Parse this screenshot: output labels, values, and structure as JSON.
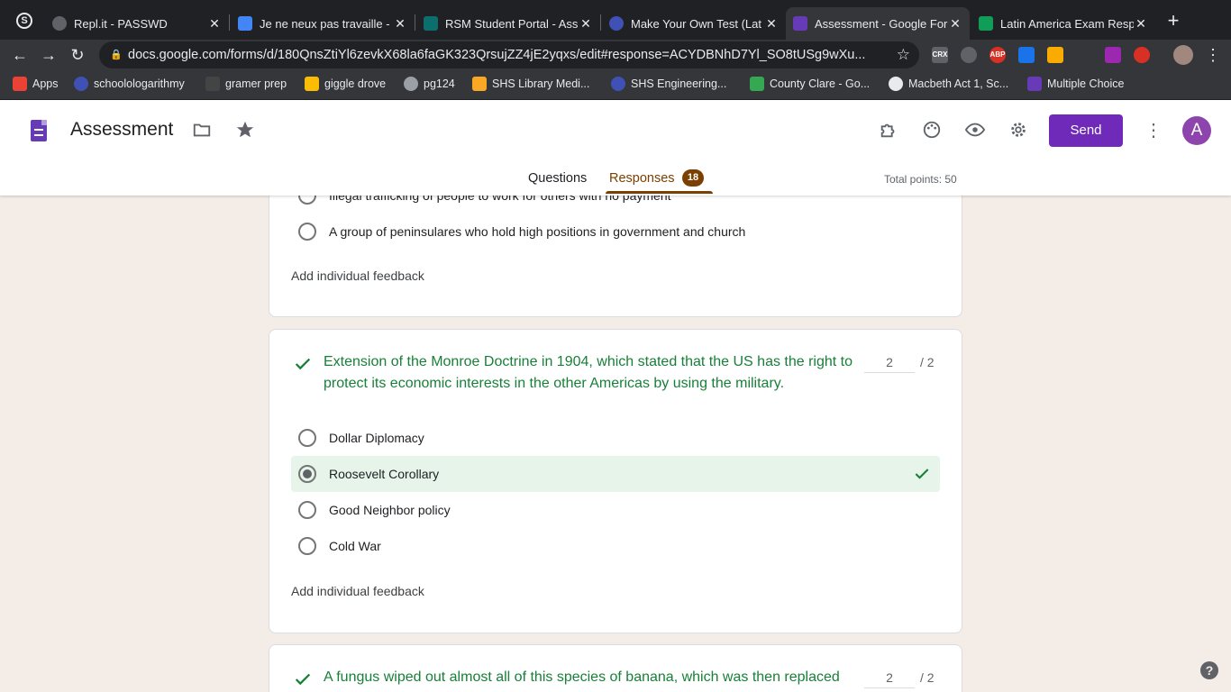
{
  "browser": {
    "tabs": [
      {
        "title": "Repl.it - PASSWD",
        "color": "#5f6368"
      },
      {
        "title": "Je ne neux pas travaille -",
        "color": "#4285f4"
      },
      {
        "title": "RSM Student Portal - Ass",
        "color": "#0d6e6e"
      },
      {
        "title": "Make Your Own Test (Lat",
        "color": "#3f51b5"
      },
      {
        "title": "Assessment - Google For",
        "color": "#673ab7"
      },
      {
        "title": "Latin America Exam Resp",
        "color": "#0f9d58"
      }
    ],
    "active_tab": 4,
    "url": "docs.google.com/forms/d/180QnsZtiYl6zevkX68la6faGK323QrsujZZ4jE2yqxs/edit#response=ACYDBNhD7Yl_SO8tUSg9wXu...",
    "bookmarks": [
      {
        "label": "Apps",
        "color": "#ea4335"
      },
      {
        "label": "schoolologarithmy",
        "color": "#3f51b5"
      },
      {
        "label": "gramer prep",
        "color": "#444444"
      },
      {
        "label": "giggle drove",
        "color": "#fbbc04"
      },
      {
        "label": "pg124",
        "color": "#9aa0a6"
      },
      {
        "label": "SHS Library Medi...",
        "color": "#f9a825"
      },
      {
        "label": "SHS Engineering...",
        "color": "#3f51b5"
      },
      {
        "label": "County Clare - Go...",
        "color": "#34a853"
      },
      {
        "label": "Macbeth Act 1, Sc...",
        "color": "#e8eaed"
      },
      {
        "label": "Multiple Choice",
        "color": "#673ab7"
      }
    ]
  },
  "form": {
    "title": "Assessment",
    "send_label": "Send",
    "avatar_letter": "A",
    "tabs": {
      "questions": "Questions",
      "responses": "Responses",
      "response_count": "18"
    },
    "total_points": "Total points: 50"
  },
  "cards": [
    {
      "partial_option": "Illegal trafficking of people to work for others with no payment",
      "option": "A group of peninsulares who hold high positions in government and church",
      "feedback": "Add individual feedback"
    },
    {
      "question": "Extension of the Monroe Doctrine in 1904, which stated that the US has the right to protect its economic interests in the other Americas by using the military.",
      "score": "2",
      "max": "/ 2",
      "options": [
        "Dollar Diplomacy",
        "Roosevelt Corollary",
        "Good Neighbor policy",
        "Cold War"
      ],
      "selected_index": 1,
      "feedback": "Add individual feedback"
    },
    {
      "question": "A fungus wiped out almost all of this species of banana, which was then replaced",
      "score": "2",
      "max": "/ 2"
    }
  ],
  "colors": {
    "accent": "#6f2ab9",
    "correct": "#188038",
    "response_brown": "#7b3f00"
  }
}
